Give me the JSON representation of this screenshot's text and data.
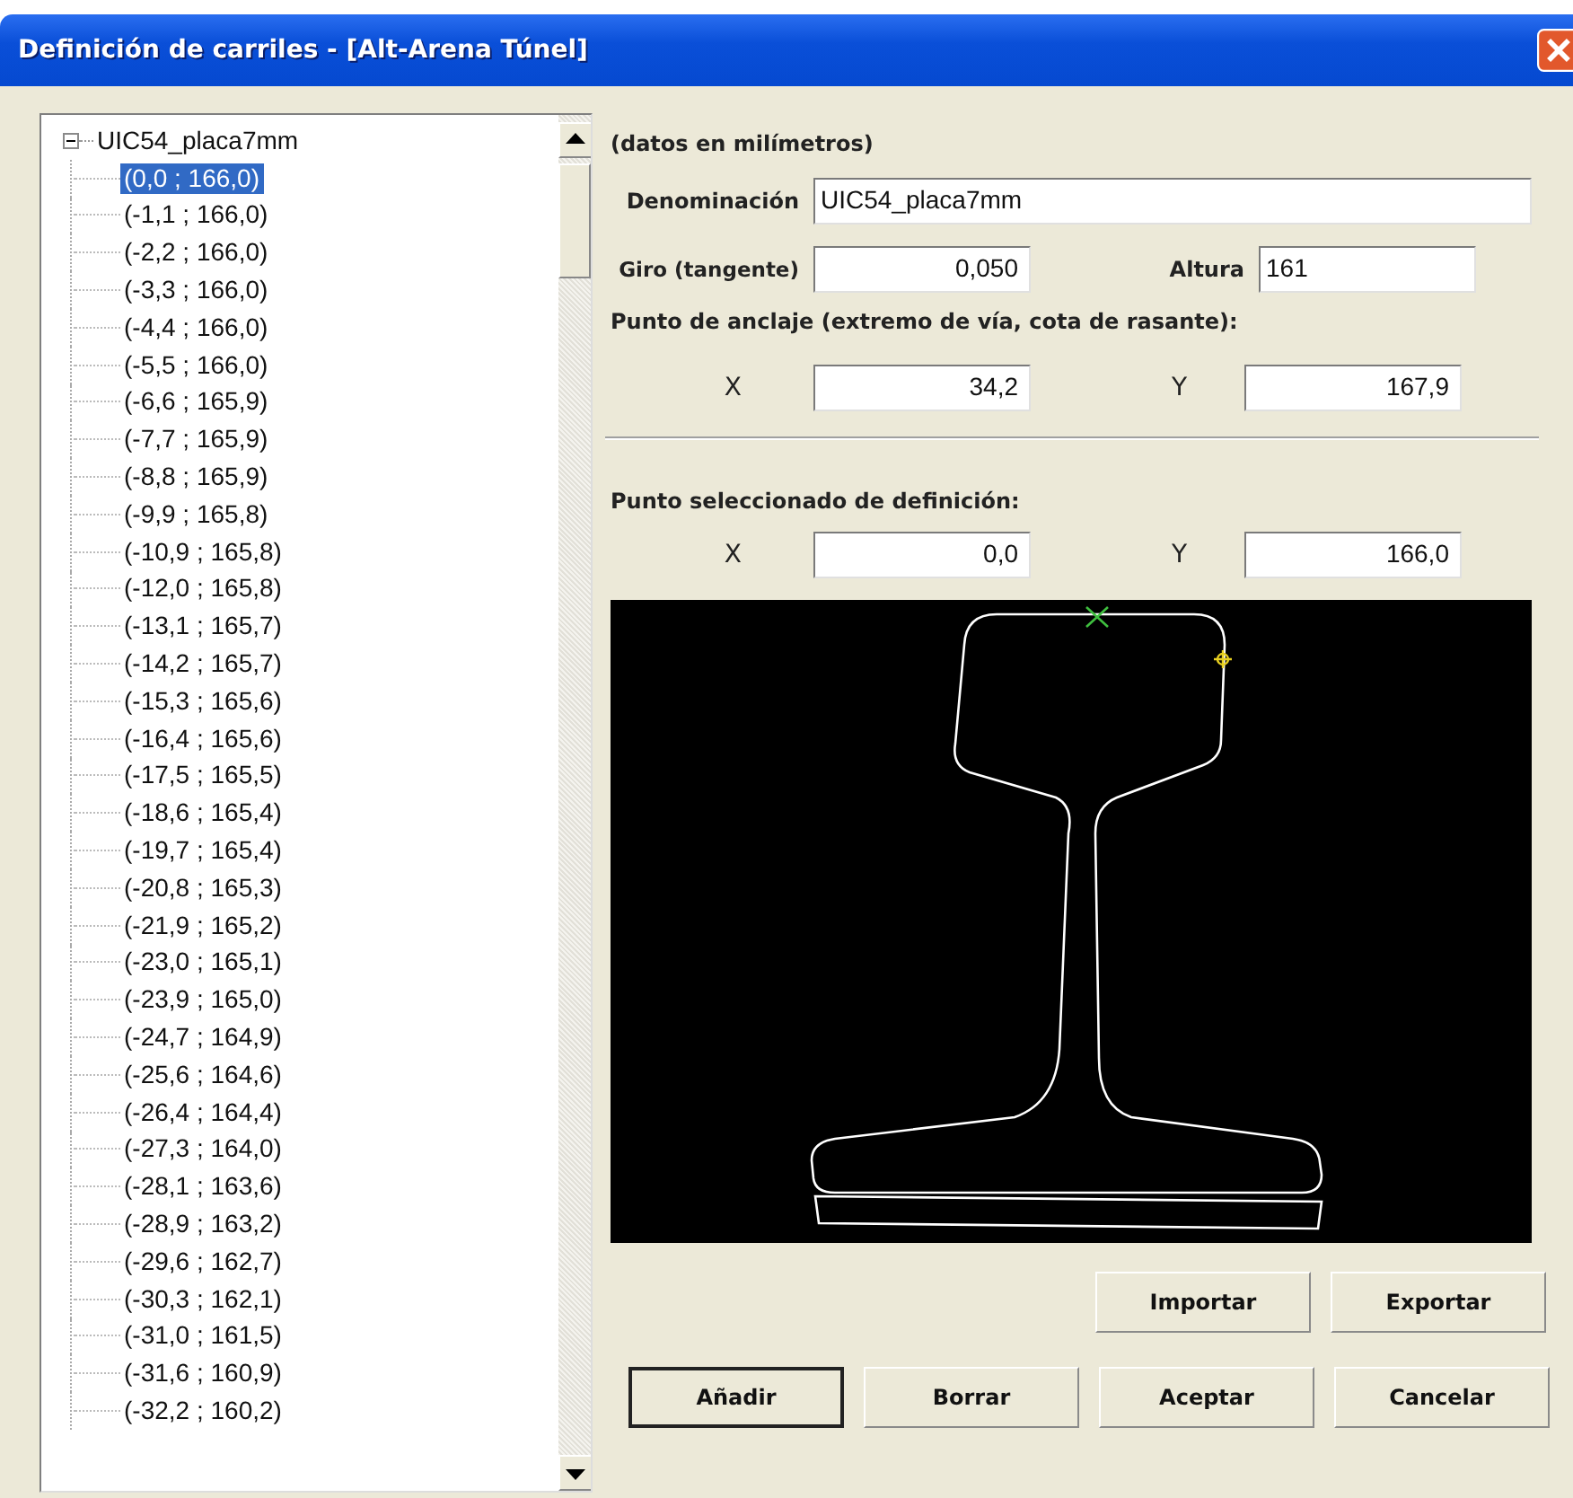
{
  "window": {
    "title": "Definición de carriles - [Alt-Arena Túnel]"
  },
  "tree": {
    "label": "UIC54_placa7mm",
    "expanded": true,
    "children": [
      {
        "label": "(0,0 ; 166,0)",
        "selected": true
      },
      {
        "label": "(-1,1 ; 166,0)",
        "selected": false
      },
      {
        "label": "(-2,2 ; 166,0)",
        "selected": false
      },
      {
        "label": "(-3,3 ; 166,0)",
        "selected": false
      },
      {
        "label": "(-4,4 ; 166,0)",
        "selected": false
      },
      {
        "label": "(-5,5 ; 166,0)",
        "selected": false
      },
      {
        "label": "(-6,6 ; 165,9)",
        "selected": false
      },
      {
        "label": "(-7,7 ; 165,9)",
        "selected": false
      },
      {
        "label": "(-8,8 ; 165,9)",
        "selected": false
      },
      {
        "label": "(-9,9 ; 165,8)",
        "selected": false
      },
      {
        "label": "(-10,9 ; 165,8)",
        "selected": false
      },
      {
        "label": "(-12,0 ; 165,8)",
        "selected": false
      },
      {
        "label": "(-13,1 ; 165,7)",
        "selected": false
      },
      {
        "label": "(-14,2 ; 165,7)",
        "selected": false
      },
      {
        "label": "(-15,3 ; 165,6)",
        "selected": false
      },
      {
        "label": "(-16,4 ; 165,6)",
        "selected": false
      },
      {
        "label": "(-17,5 ; 165,5)",
        "selected": false
      },
      {
        "label": "(-18,6 ; 165,4)",
        "selected": false
      },
      {
        "label": "(-19,7 ; 165,4)",
        "selected": false
      },
      {
        "label": "(-20,8 ; 165,3)",
        "selected": false
      },
      {
        "label": "(-21,9 ; 165,2)",
        "selected": false
      },
      {
        "label": "(-23,0 ; 165,1)",
        "selected": false
      },
      {
        "label": "(-23,9 ; 165,0)",
        "selected": false
      },
      {
        "label": "(-24,7 ; 164,9)",
        "selected": false
      },
      {
        "label": "(-25,6 ; 164,6)",
        "selected": false
      },
      {
        "label": "(-26,4 ; 164,4)",
        "selected": false
      },
      {
        "label": "(-27,3 ; 164,0)",
        "selected": false
      },
      {
        "label": "(-28,1 ; 163,6)",
        "selected": false
      },
      {
        "label": "(-28,9 ; 163,2)",
        "selected": false
      },
      {
        "label": "(-29,6 ; 162,7)",
        "selected": false
      },
      {
        "label": "(-30,3 ; 162,1)",
        "selected": false
      },
      {
        "label": "(-31,0 ; 161,5)",
        "selected": false
      },
      {
        "label": "(-31,6 ; 160,9)",
        "selected": false
      },
      {
        "label": "(-32,2 ; 160,2)",
        "selected": false
      }
    ]
  },
  "units_note": "(datos en milímetros)",
  "name_field": {
    "label": "Denominación",
    "value": "UIC54_placa7mm"
  },
  "rotation_field": {
    "label": "Giro (tangente)",
    "value": "0,050"
  },
  "height_field": {
    "label": "Altura",
    "value": "161"
  },
  "anchor": {
    "heading": "Punto de anclaje (extremo de vía, cota de rasante):",
    "x": {
      "label": "X",
      "value": "34,2"
    },
    "y": {
      "label": "Y",
      "value": "167,9"
    }
  },
  "selected_point": {
    "heading": "Punto seleccionado de definición:",
    "x": {
      "label": "X",
      "value": "0,0"
    },
    "y": {
      "label": "Y",
      "value": "166,0"
    }
  },
  "buttons_top": [
    {
      "label": "Importar",
      "default": false
    },
    {
      "label": "Exportar",
      "default": false
    }
  ],
  "buttons_bottom": [
    {
      "label": "Añadir",
      "default": true
    },
    {
      "label": "Borrar",
      "default": false
    },
    {
      "label": "Aceptar",
      "default": false
    },
    {
      "label": "Cancelar",
      "default": false
    }
  ]
}
